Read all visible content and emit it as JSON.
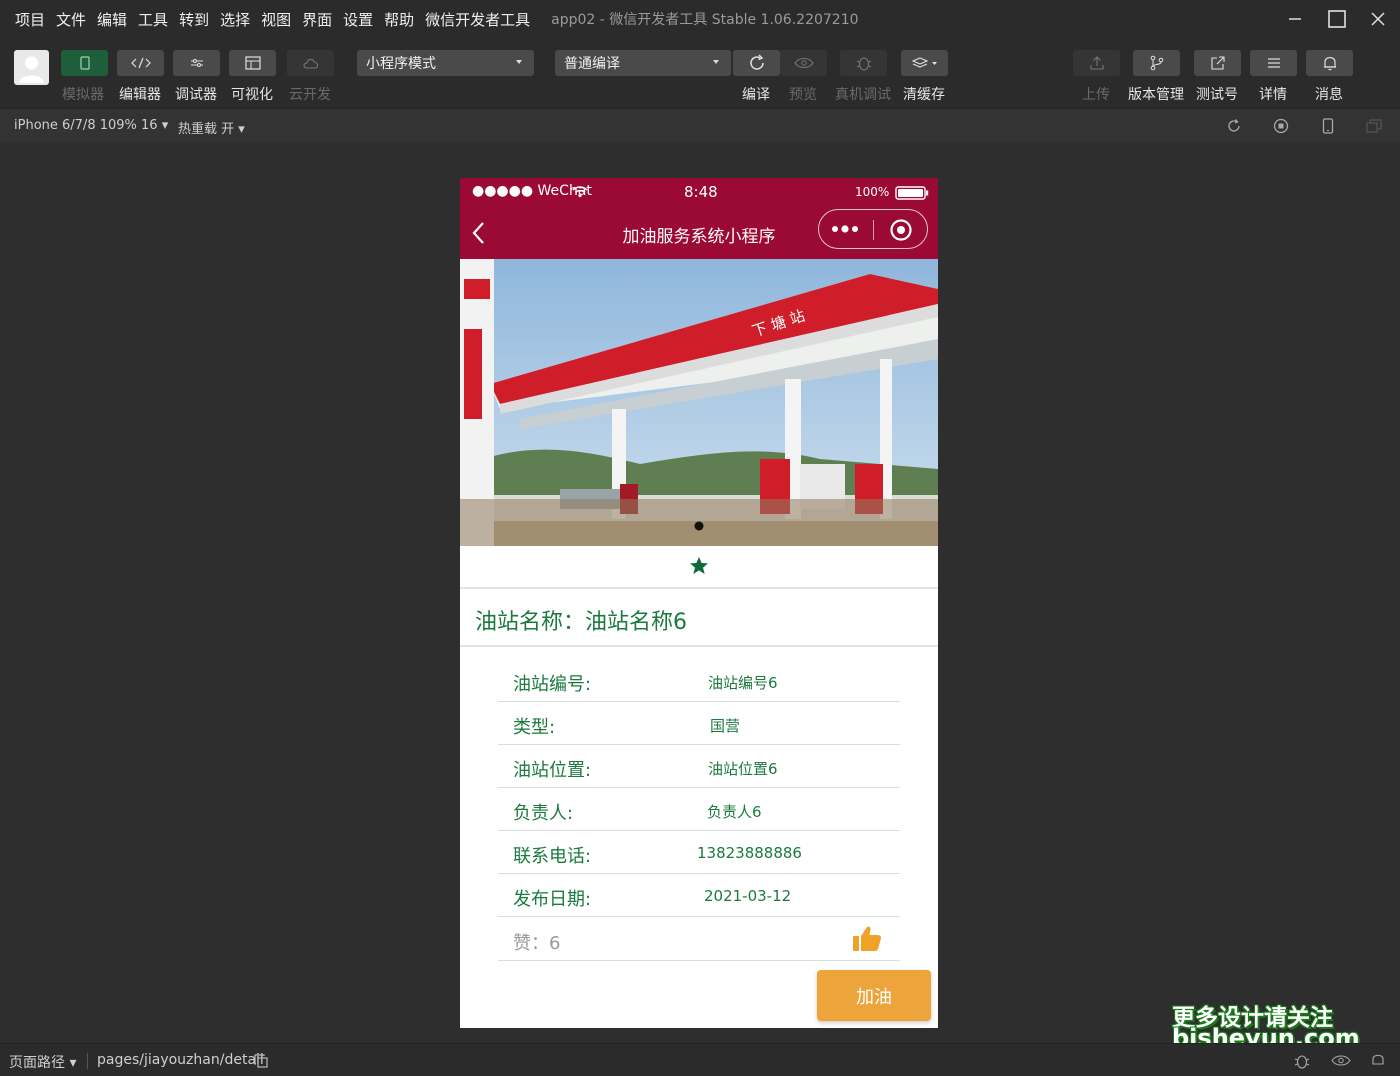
{
  "menu": {
    "items": [
      "项目",
      "文件",
      "编辑",
      "工具",
      "转到",
      "选择",
      "视图",
      "界面",
      "设置",
      "帮助",
      "微信开发者工具"
    ],
    "window_title": "app02 - 微信开发者工具 Stable 1.06.2207210"
  },
  "toolbar": {
    "simulator": "模拟器",
    "editor": "编辑器",
    "debugger": "调试器",
    "visual": "可视化",
    "cloud": "云开发",
    "mode_select": "小程序模式",
    "compile_select": "普通编译",
    "compile": "编译",
    "preview": "预览",
    "remote_debug": "真机调试",
    "clear_cache": "清缓存",
    "upload": "上传",
    "version": "版本管理",
    "test_id": "测试号",
    "details": "详情",
    "messages": "消息"
  },
  "subbar": {
    "device": "iPhone 6/7/8 109% 16 ▾",
    "hot_reload": "热重载 开 ▾"
  },
  "phone": {
    "carrier": "●●●●● WeChat",
    "time": "8:48",
    "battery": "100%",
    "nav_title": "加油服务系统小程序",
    "station_title": "油站名称：油站名称6",
    "details": [
      {
        "label": "油站编号:",
        "value": "油站编号6"
      },
      {
        "label": "类型:",
        "value": "国营"
      },
      {
        "label": "油站位置:",
        "value": "油站位置6"
      },
      {
        "label": "负责人:",
        "value": "负责人6"
      },
      {
        "label": "联系电话:",
        "value": "13823888886"
      },
      {
        "label": "发布日期:",
        "value": "2021-03-12"
      }
    ],
    "likes_label": "赞：",
    "likes_value": "6",
    "refuel_button": "加油",
    "banner_signs": {
      "canopy": "下 塘 站"
    }
  },
  "bottombar": {
    "page_path_label": "页面路径 ▾",
    "page_path": "pages/jiayouzhan/detail"
  },
  "watermark": {
    "line1": "更多设计请关注",
    "line2": "bisheyun.com"
  },
  "colors": {
    "brand": "#9b0a35",
    "text_green": "#1b7a3e",
    "button_orange": "#eda43a"
  }
}
